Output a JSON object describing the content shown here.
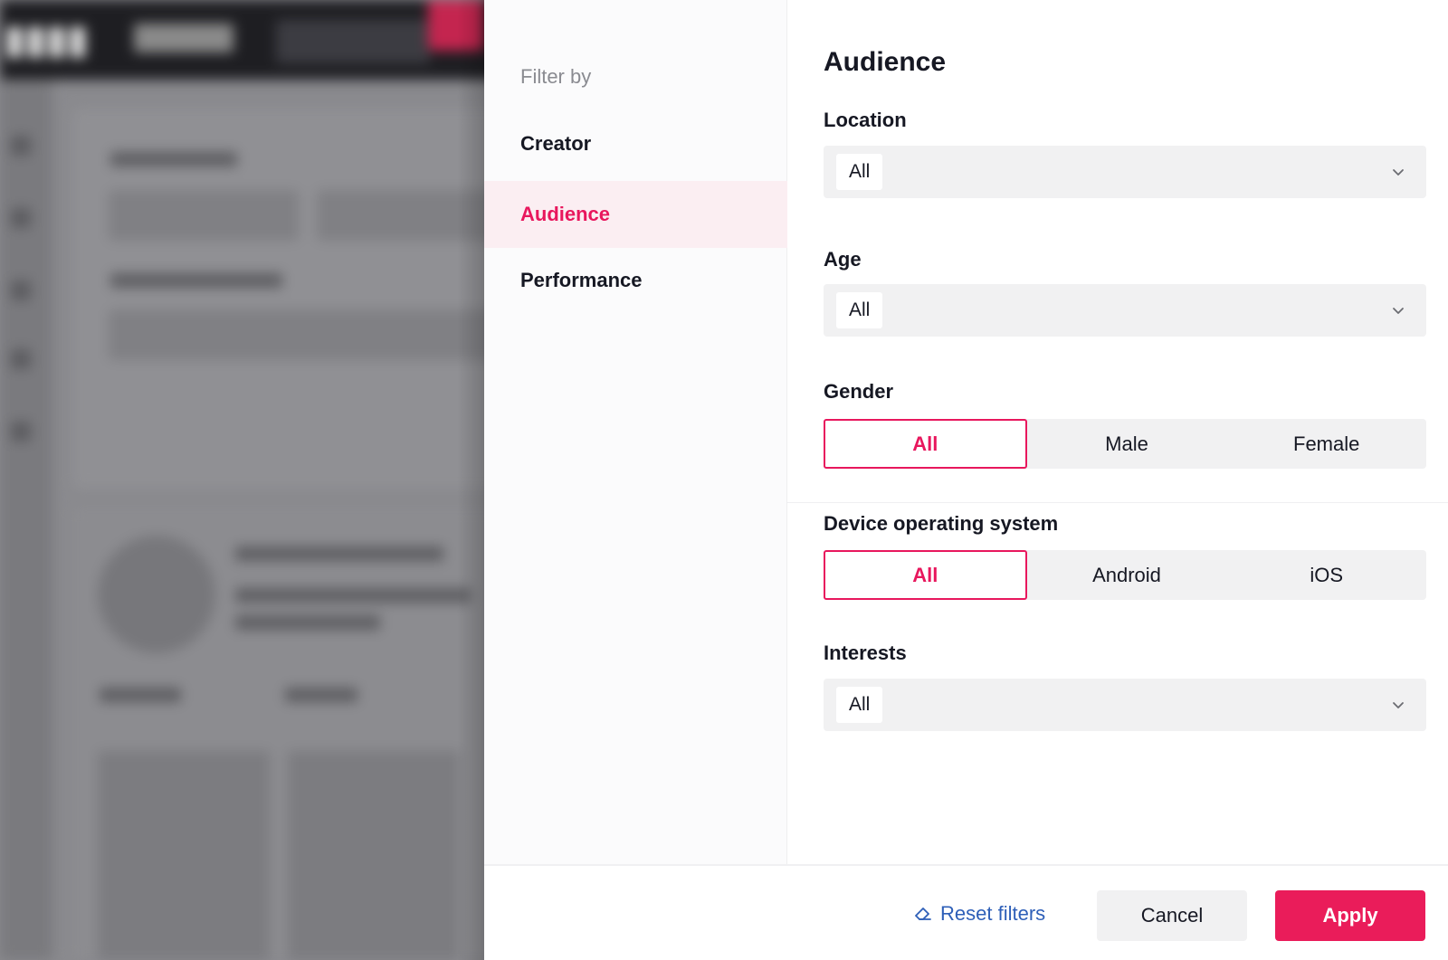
{
  "nav": {
    "heading": "Filter by",
    "items": [
      {
        "label": "Creator",
        "active": false
      },
      {
        "label": "Audience",
        "active": true
      },
      {
        "label": "Performance",
        "active": false
      }
    ]
  },
  "audience": {
    "title": "Audience",
    "location": {
      "label": "Location",
      "value": "All",
      "icon": "chevron-down-icon"
    },
    "age": {
      "label": "Age",
      "value": "All",
      "icon": "chevron-down-icon"
    },
    "gender": {
      "label": "Gender",
      "options": [
        "All",
        "Male",
        "Female"
      ],
      "selected": "All"
    },
    "device_os": {
      "label": "Device operating system",
      "options": [
        "All",
        "Android",
        "iOS"
      ],
      "selected": "All"
    },
    "interests": {
      "label": "Interests",
      "value": "All",
      "icon": "chevron-down-icon"
    }
  },
  "footer": {
    "reset_label": "Reset filters",
    "reset_icon": "eraser-icon",
    "cancel_label": "Cancel",
    "apply_label": "Apply"
  },
  "colors": {
    "accent": "#e8175d",
    "link": "#2e5fb8",
    "active_nav_bg": "#fbeef2"
  }
}
